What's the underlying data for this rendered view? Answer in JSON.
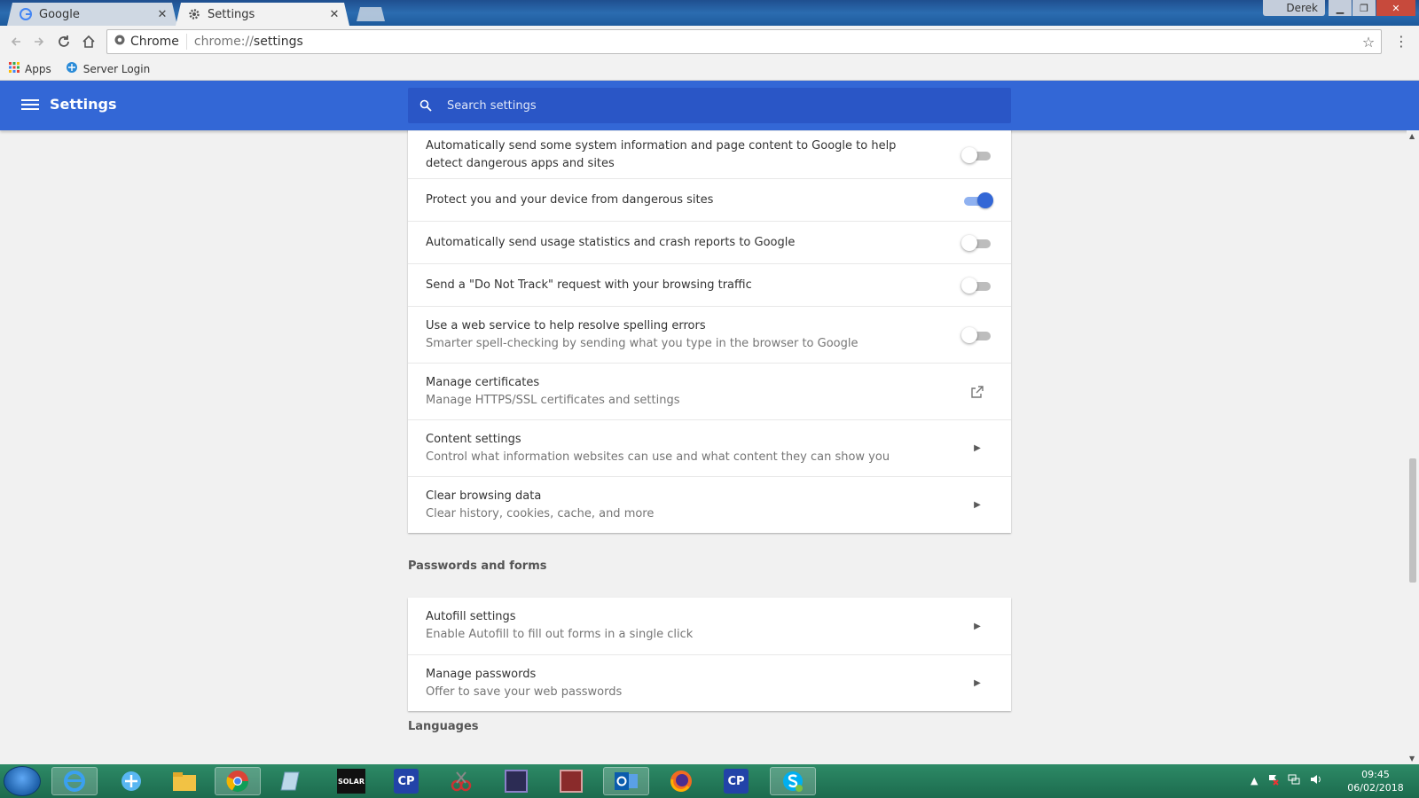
{
  "browser": {
    "tabs": [
      {
        "title": "Google",
        "active": false
      },
      {
        "title": "Settings",
        "active": true
      }
    ],
    "profile_name": "Derek",
    "omnibox": {
      "chip_label": "Chrome",
      "url_scheme": "chrome://",
      "url_path": "settings"
    },
    "bookmarks": [
      {
        "label": "Apps",
        "icon": "apps-grid-icon"
      },
      {
        "label": "Server Login",
        "icon": "server-icon"
      }
    ]
  },
  "header": {
    "title": "Settings",
    "search_placeholder": "Search settings"
  },
  "privacy_card": {
    "rows": [
      {
        "label": "Automatically send some system information and page content to Google to help detect dangerous apps and sites",
        "control": "toggle",
        "enabled": false
      },
      {
        "label": "Protect you and your device from dangerous sites",
        "control": "toggle",
        "enabled": true
      },
      {
        "label": "Automatically send usage statistics and crash reports to Google",
        "control": "toggle",
        "enabled": false
      },
      {
        "label": "Send a \"Do Not Track\" request with your browsing traffic",
        "control": "toggle",
        "enabled": false
      },
      {
        "label": "Use a web service to help resolve spelling errors",
        "sublabel": "Smarter spell-checking by sending what you type in the browser to Google",
        "control": "toggle",
        "enabled": false
      },
      {
        "label": "Manage certificates",
        "sublabel": "Manage HTTPS/SSL certificates and settings",
        "control": "external"
      },
      {
        "label": "Content settings",
        "sublabel": "Control what information websites can use and what content they can show you",
        "control": "arrow"
      },
      {
        "label": "Clear browsing data",
        "sublabel": "Clear history, cookies, cache, and more",
        "control": "arrow"
      }
    ]
  },
  "passwords_section": {
    "title": "Passwords and forms",
    "rows": [
      {
        "label": "Autofill settings",
        "sublabel": "Enable Autofill to fill out forms in a single click",
        "control": "arrow"
      },
      {
        "label": "Manage passwords",
        "sublabel": "Offer to save your web passwords",
        "control": "arrow"
      }
    ]
  },
  "languages_section": {
    "title": "Languages"
  },
  "taskbar": {
    "apps": [
      "internet-explorer-icon",
      "network-app-icon",
      "file-explorer-icon",
      "chrome-icon",
      "notepad-icon",
      "solar-app-icon",
      "cp-app-icon",
      "snipping-tool-icon",
      "media-app-icon",
      "archive-app-icon",
      "outlook-icon",
      "firefox-icon",
      "cp-app-icon-2",
      "skype-icon"
    ],
    "solar_label": "SOLAR",
    "cp_label": "CP",
    "time": "09:45",
    "date": "06/02/2018"
  },
  "colors": {
    "accent": "#3367d6",
    "header_search": "#2a56c6",
    "taskbar": "#1f7455"
  }
}
